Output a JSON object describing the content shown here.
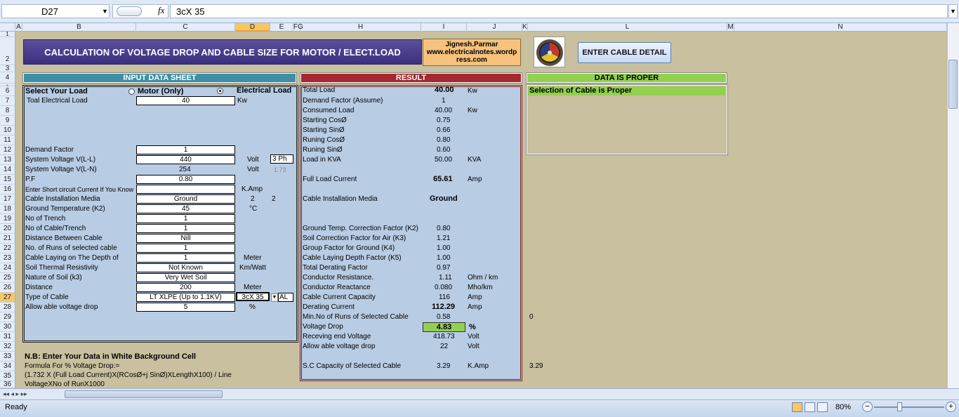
{
  "formula_bar": {
    "name_box": "D27",
    "fx_label": "fx",
    "formula": "3cX 35"
  },
  "columns": [
    "A",
    "B",
    "C",
    "D",
    "E",
    "FG",
    "H",
    "I",
    "J",
    "K",
    "L",
    "M",
    "N"
  ],
  "rows": [
    "1",
    "2",
    "3",
    "4",
    "5",
    "6",
    "7",
    "8",
    "9",
    "10",
    "11",
    "12",
    "13",
    "14",
    "15",
    "16",
    "17",
    "18",
    "19",
    "20",
    "21",
    "22",
    "23",
    "24",
    "25",
    "26",
    "27",
    "28",
    "29",
    "30",
    "31",
    "32",
    "33",
    "34",
    "35",
    "36"
  ],
  "header": {
    "title": "CALCULATION OF VOLTAGE DROP AND CABLE SIZE FOR MOTOR / ELECT.LOAD",
    "author_line1": "Jignesh.Parmar",
    "author_line2": "www.electricalnotes.wordp",
    "author_line3": "ress.com",
    "button": "ENTER CABLE DETAIL"
  },
  "sections": {
    "input": "INPUT DATA SHEET",
    "result": "RESULT",
    "status": "DATA IS PROPER"
  },
  "input": {
    "select_load": "Select Your Load",
    "motor_option": "Motor (Only)",
    "elec_option": "Electrical Load",
    "total_load_label": "Toal Electrical Load",
    "total_load_value": "40",
    "total_load_unit": "Kw",
    "demand_label": "Demand Factor",
    "demand_value": "1",
    "sysv_ll_label": "System Voltage  V(L-L)",
    "sysv_ll_value": "440",
    "sysv_ll_unit": "Volt",
    "phase": "3 Ph",
    "sysv_ln_label": "System Voltage  V(L-N)",
    "sysv_ln_value": "254",
    "sysv_ln_unit": "Volt",
    "sqrt3": "1.73",
    "pf_label": "P.F",
    "pf_value": "0.80",
    "sc_label": "Enter Short circuit Current If You Know",
    "sc_value": "",
    "sc_unit": "K.Amp",
    "media_label": "Cable Installation Media",
    "media_value": "Ground",
    "media_n1": "2",
    "media_n2": "2",
    "gtemp_label": "Ground Temperature (K2)",
    "gtemp_value": "45",
    "gtemp_unit": "°C",
    "trench_label": "No of Trench",
    "trench_value": "1",
    "cpt_label": "No of Cable/Trench",
    "cpt_value": "1",
    "dist_between_label": "Distance Between Cable",
    "dist_between_value": "Nill",
    "runs_label": "No. of Runs of selected cable",
    "runs_value": "1",
    "depth_label": "Cable Laying on The Depth of",
    "depth_value": "1",
    "depth_unit": "Meter",
    "thermal_label": "Soil Thermal Resistivity",
    "thermal_value": "Not Known",
    "thermal_unit": "Km/Watt",
    "soil_label": "Nature of Soil (k3)",
    "soil_value": "Very Wet Soil",
    "distance_label": "Distance",
    "distance_value": "200",
    "distance_unit": "Meter",
    "cable_type_label": "Type of Cable",
    "cable_type_value": "LT XLPE (Up to 1.1KV)",
    "cable_size_value": "3cX 35",
    "material": "AL",
    "allow_label": "Allow able voltage drop",
    "allow_value": "5",
    "allow_unit": "%"
  },
  "result": {
    "total_load_label": "Total Load",
    "total_load_value": "40.00",
    "total_load_unit": "Kw",
    "demand_label": "Demand Factor (Assume)",
    "demand_value": "1",
    "consumed_label": "Consumed Load",
    "consumed_value": "40.00",
    "consumed_unit": "Kw",
    "start_cos_label": "Starting CosØ",
    "start_cos_value": "0.75",
    "start_sin_label": "Starting SinØ",
    "start_sin_value": "0.66",
    "run_cos_label": "Runing CosØ",
    "run_cos_value": "0.80",
    "run_sin_label": "Runing SinØ",
    "run_sin_value": "0.60",
    "kva_label": "Load in  KVA",
    "kva_value": "50.00",
    "kva_unit": "KVA",
    "flc_label": "Full Load Current",
    "flc_value": "65.61",
    "flc_unit": "Amp",
    "media_label": "Cable Installation Media",
    "media_value": "Ground",
    "k2_label": "Ground Temp. Correction Factor (K2)",
    "k2_value": "0.80",
    "k3_label": "Soil Correction Factor for Air (K3)",
    "k3_value": "1.21",
    "k4_label": "Group Factor for Ground (K4)",
    "k4_value": "1.00",
    "k5_label": "Cable Laying Depth Factor (K5)",
    "k5_value": "1.00",
    "tdf_label": "Total Derating Factor",
    "tdf_value": "0.97",
    "res_label": "Conductor Resistance.",
    "res_value": "1.11",
    "res_unit": "Ohm / km",
    "react_label": "Conductor Reactance",
    "react_value": "0.080",
    "react_unit": "Mho/km",
    "ccc_label": "Cable Current Capacity",
    "ccc_value": "116",
    "ccc_unit": "Amp",
    "derate_label": "Derating  Current",
    "derate_value": "112.29",
    "derate_unit": "Amp",
    "minruns_label": "Min.No of Runs of Selected Cable",
    "minruns_value": "0.58",
    "vdrop_label": "Voltage Drop",
    "vdrop_value": "4.83",
    "vdrop_unit": "%",
    "recv_label": "Receving end Voltage",
    "recv_value": "418.73",
    "recv_unit": "Volt",
    "allow_label": "Allow able voltage drop",
    "allow_value": "22",
    "allow_unit": "Volt",
    "sc_label": "S.C Capacity of Selected Cable",
    "sc_value": "3.29",
    "sc_unit": "K.Amp"
  },
  "status_msg": "Selection of Cable is Proper",
  "side_values": {
    "row29": "0",
    "row34": "3.29"
  },
  "notes": {
    "nb": "N.B: Enter Your Data in White Background Cell",
    "formula_title": "Formula For % Voltage Drop:=",
    "formula_line1": "(1.732 X (Full Load Current)X(RCosØ+j SinØ)XLengthX100) / Line",
    "formula_line2": "VoltageXNo of RunX1000"
  },
  "statusbar": {
    "ready": "Ready",
    "zoom": "80%"
  },
  "colors": {
    "title": "#3b2f80",
    "input_hdr": "#3e8fa6",
    "result_hdr": "#a3282f",
    "ok": "#92d050",
    "panel": "#b8cce4",
    "sheet": "#c8c09e"
  }
}
